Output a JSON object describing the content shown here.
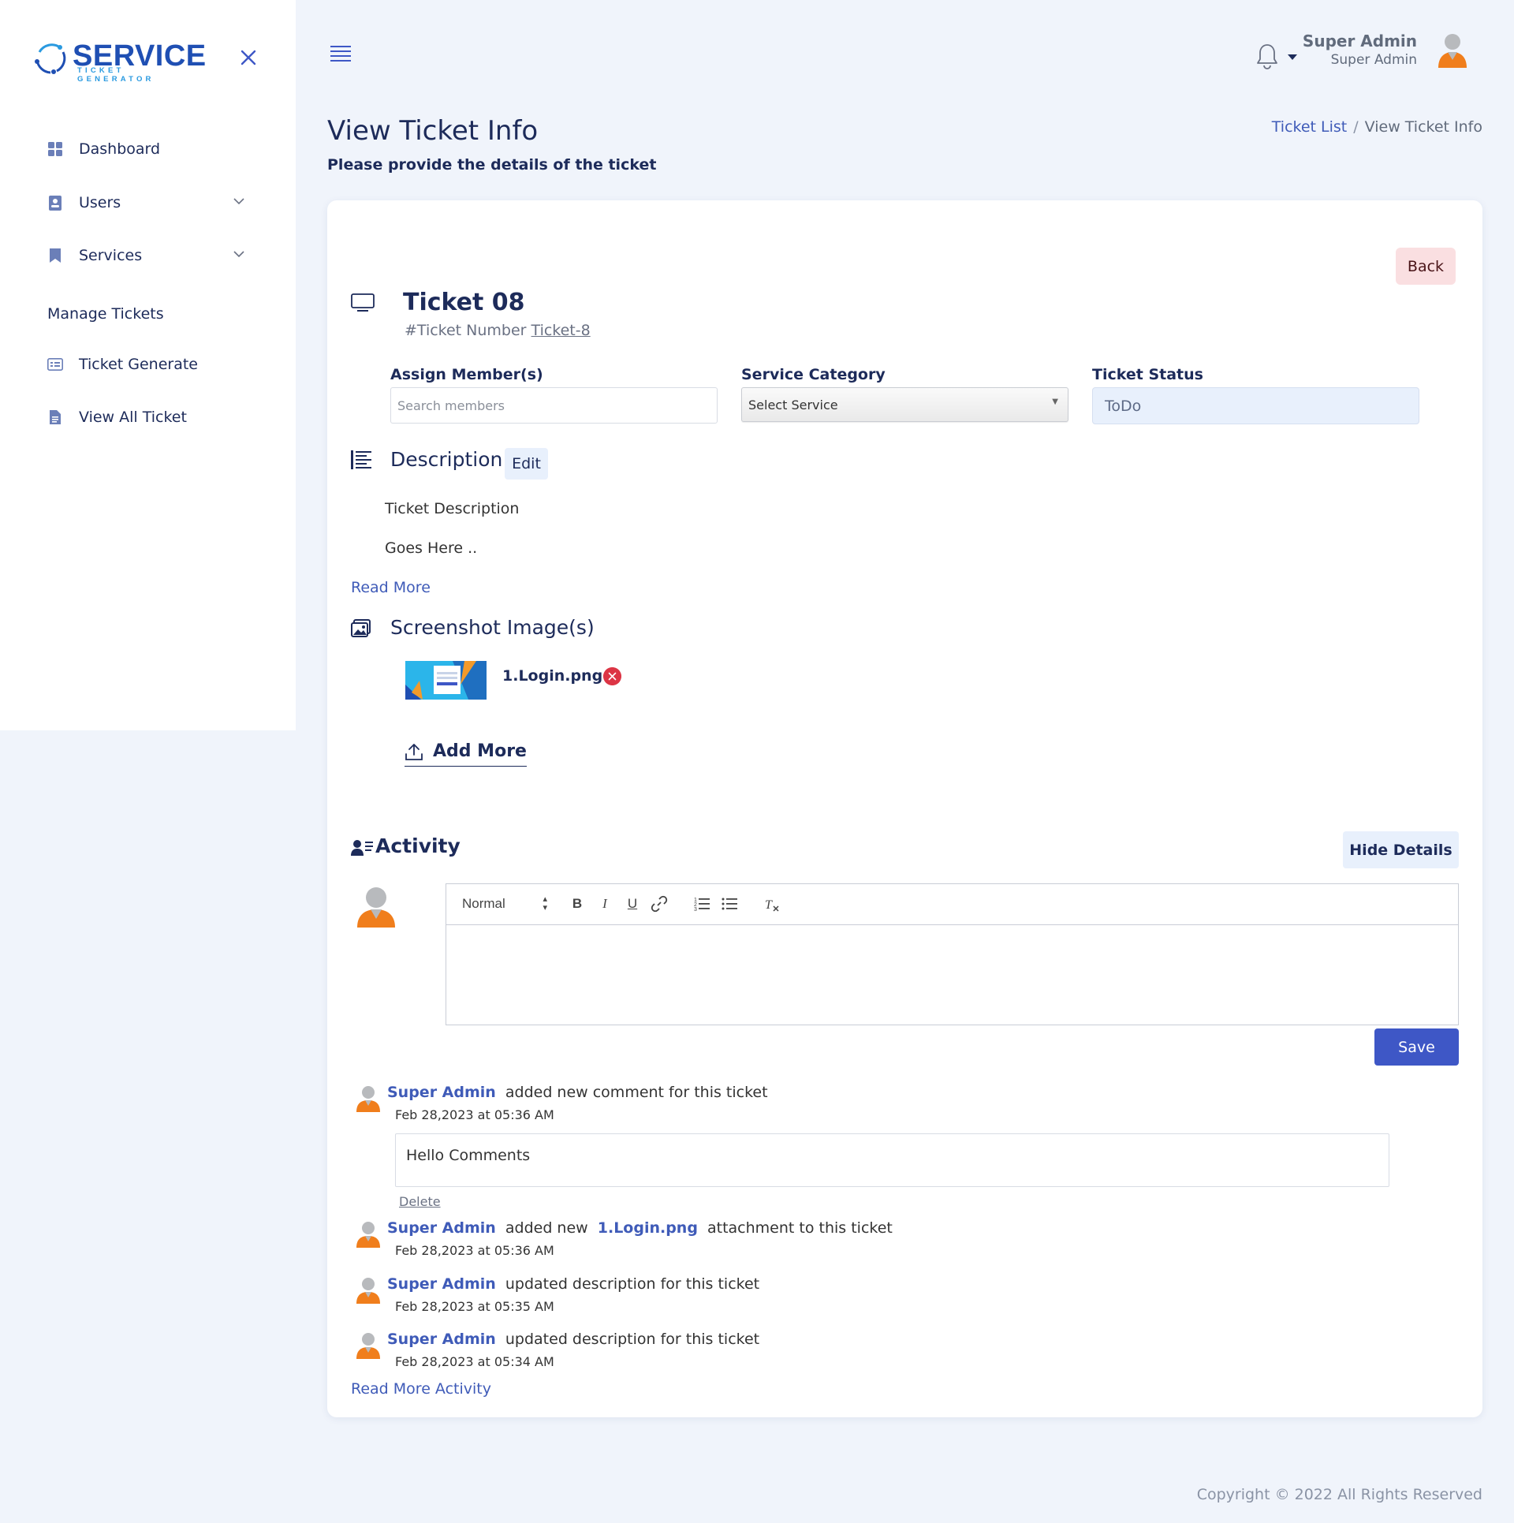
{
  "brand": {
    "name": "SERVICE",
    "tagline": "TICKET GENERATOR",
    "primary": "#1f4fb3",
    "secondary": "#2a9ae0"
  },
  "sidebar": {
    "items": [
      {
        "label": "Dashboard",
        "icon": "dashboard-grid-icon"
      },
      {
        "label": "Users",
        "icon": "user-badge-icon",
        "expandable": true
      },
      {
        "label": "Services",
        "icon": "bookmark-icon",
        "expandable": true
      }
    ],
    "section_heading": "Manage Tickets",
    "ticket_items": [
      {
        "label": "Ticket Generate",
        "icon": "ticket-list-icon"
      },
      {
        "label": "View All Ticket",
        "icon": "document-icon"
      }
    ]
  },
  "header": {
    "user_name": "Super Admin",
    "user_role": "Super Admin"
  },
  "page": {
    "title": "View Ticket Info",
    "subtitle": "Please provide the details of the ticket",
    "breadcrumb": {
      "parent": "Ticket List",
      "separator": "/",
      "current": "View Ticket Info"
    }
  },
  "ticket": {
    "back_label": "Back",
    "title": "Ticket 08",
    "number_prefix": "#Ticket Number",
    "number": "Ticket-8",
    "assign_label": "Assign Member(s)",
    "assign_placeholder": "Search members",
    "category_label": "Service Category",
    "category_value": "Select Service",
    "status_label": "Ticket Status",
    "status_value": "ToDo"
  },
  "description": {
    "title": "Description",
    "edit_label": "Edit",
    "lines": [
      "Ticket Description",
      "Goes Here .."
    ],
    "read_more": "Read More"
  },
  "screenshots": {
    "title": "Screenshot Image(s)",
    "files": [
      {
        "name": "1.Login.png"
      }
    ],
    "add_more": "Add More"
  },
  "activity": {
    "title": "Activity",
    "hide_label": "Hide Details",
    "editor": {
      "format": "Normal",
      "tools": [
        "bold",
        "italic",
        "underline",
        "link",
        "ordered-list",
        "bullet-list",
        "clear-format"
      ]
    },
    "save_label": "Save",
    "entries": [
      {
        "user": "Super Admin",
        "text": "added new comment for this ticket",
        "date": "Feb 28,2023 at 05:36 AM",
        "comment": "Hello Comments",
        "delete_label": "Delete"
      },
      {
        "user": "Super Admin",
        "text_before": "added new",
        "attachment": "1.Login.png",
        "text_after": "attachment to this ticket",
        "date": "Feb 28,2023 at 05:36 AM"
      },
      {
        "user": "Super Admin",
        "text": "updated description for this ticket",
        "date": "Feb 28,2023 at 05:35 AM"
      },
      {
        "user": "Super Admin",
        "text": "updated description for this ticket",
        "date": "Feb 28,2023 at 05:34 AM"
      }
    ],
    "read_more": "Read More Activity"
  },
  "footer": {
    "copyright": "Copyright © 2022 All Rights Reserved"
  },
  "colors": {
    "accent": "#3e57c6",
    "link": "#3f5bb8",
    "danger": "#dc3545",
    "avatar": "#f07e1c"
  }
}
